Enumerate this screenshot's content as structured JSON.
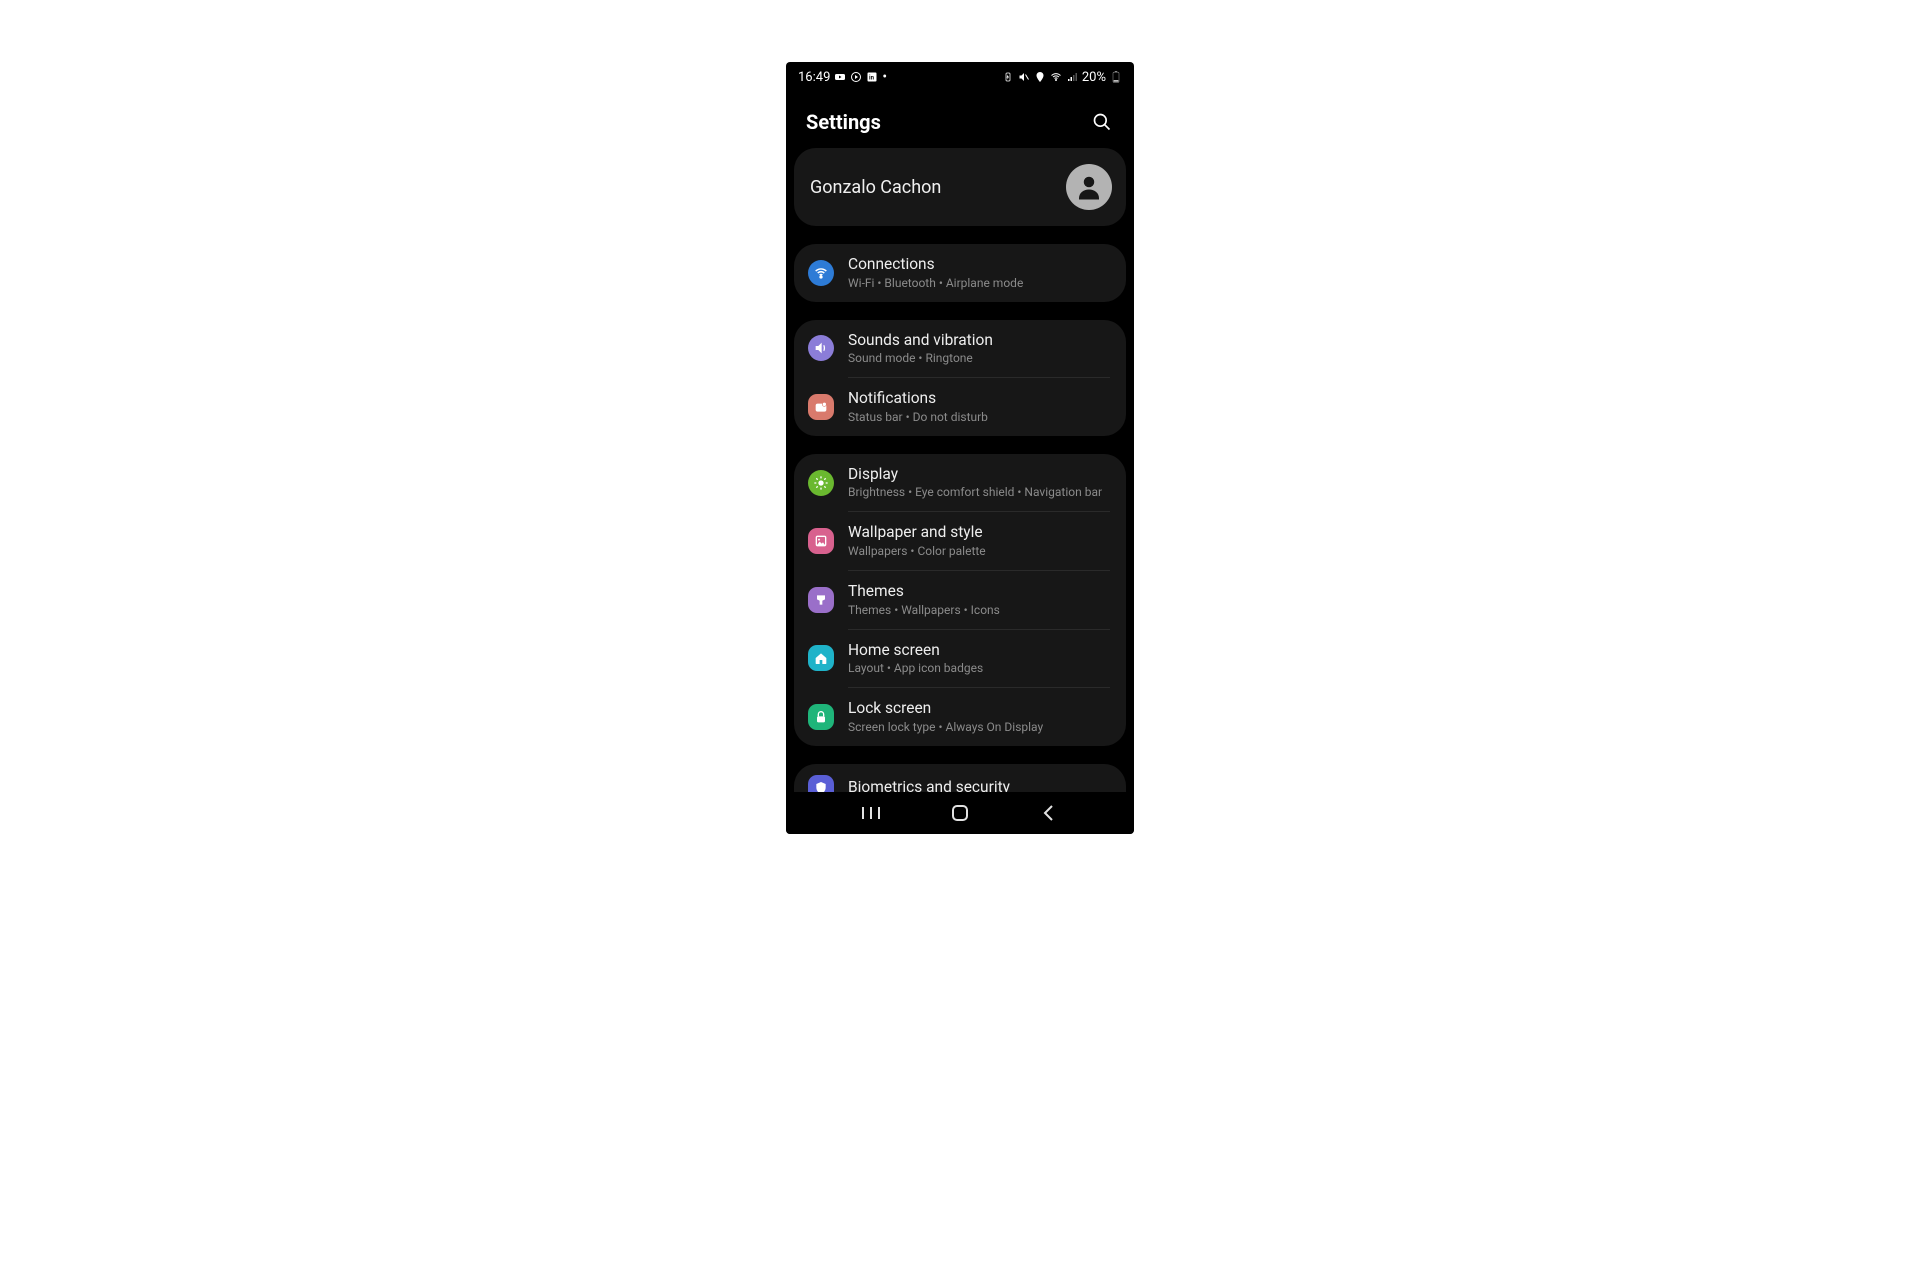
{
  "statusbar": {
    "time": "16:49",
    "battery_pct": "20%"
  },
  "header": {
    "title": "Settings"
  },
  "profile": {
    "name": "Gonzalo Cachon"
  },
  "groups": [
    {
      "items": [
        {
          "title": "Connections",
          "subtitle": "Wi-Fi  •  Bluetooth  •  Airplane mode"
        }
      ]
    },
    {
      "items": [
        {
          "title": "Sounds and vibration",
          "subtitle": "Sound mode  •  Ringtone"
        },
        {
          "title": "Notifications",
          "subtitle": "Status bar  •  Do not disturb"
        }
      ]
    },
    {
      "items": [
        {
          "title": "Display",
          "subtitle": "Brightness  •  Eye comfort shield  •  Navigation bar"
        },
        {
          "title": "Wallpaper and style",
          "subtitle": "Wallpapers  •  Color palette"
        },
        {
          "title": "Themes",
          "subtitle": "Themes  •  Wallpapers  •  Icons"
        },
        {
          "title": "Home screen",
          "subtitle": "Layout  •  App icon badges"
        },
        {
          "title": "Lock screen",
          "subtitle": "Screen lock type  •  Always On Display"
        }
      ]
    },
    {
      "items": [
        {
          "title": "Biometrics and security",
          "subtitle": ""
        }
      ]
    }
  ]
}
